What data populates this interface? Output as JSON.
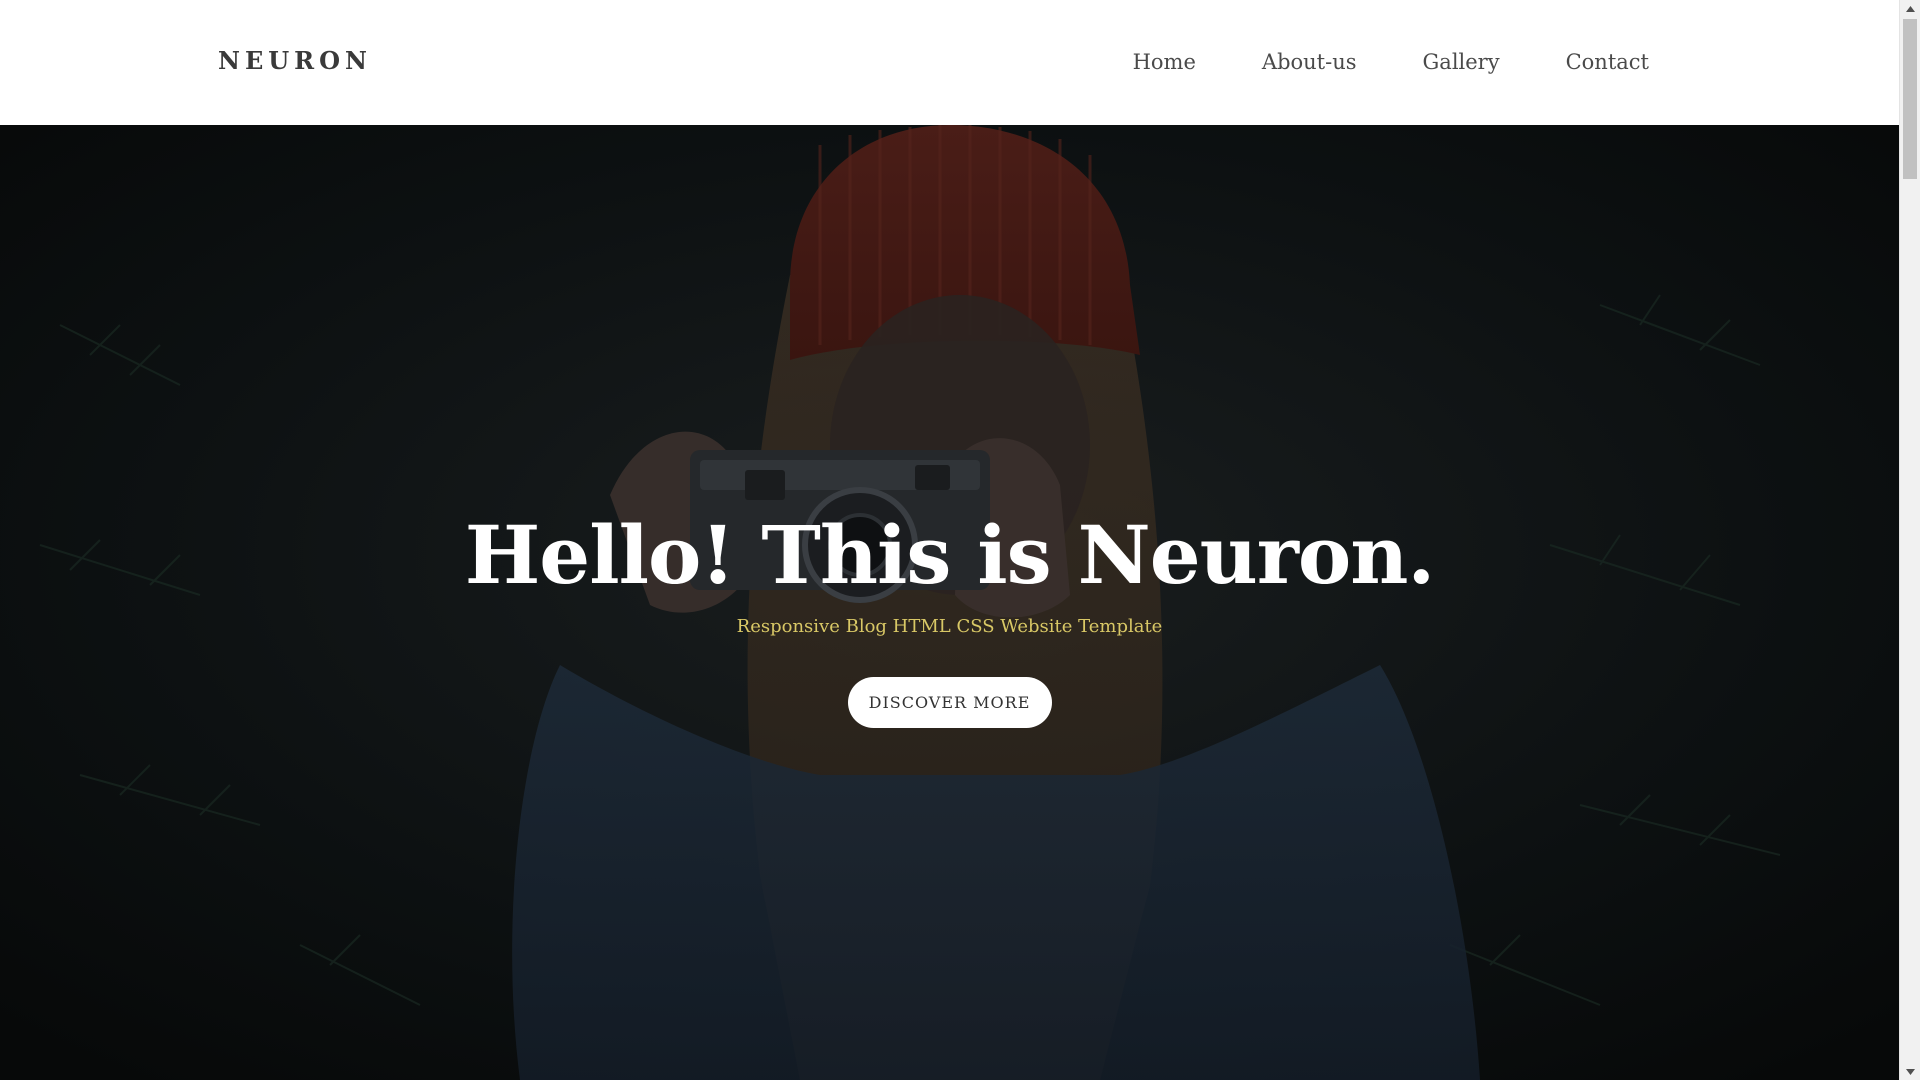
{
  "navbar": {
    "brand": "NEURON",
    "links": [
      {
        "label": "Home"
      },
      {
        "label": "About-us"
      },
      {
        "label": "Gallery"
      },
      {
        "label": "Contact"
      }
    ]
  },
  "hero": {
    "title": "Hello! This is Neuron.",
    "subtitle": "Responsive Blog HTML CSS Website Template",
    "button_label": "DISCOVER MORE",
    "background_image": "photo of a woman in a red beanie holding a camera in front of evergreen trees (darkened overlay)"
  },
  "colors": {
    "nav_background": "#ffffff",
    "brand_text": "#3a3a3a",
    "nav_text": "#4a4a4a",
    "hero_title": "#ffffff",
    "hero_subtitle": "#d9c866",
    "button_background": "#ffffff",
    "button_text": "#333333"
  }
}
